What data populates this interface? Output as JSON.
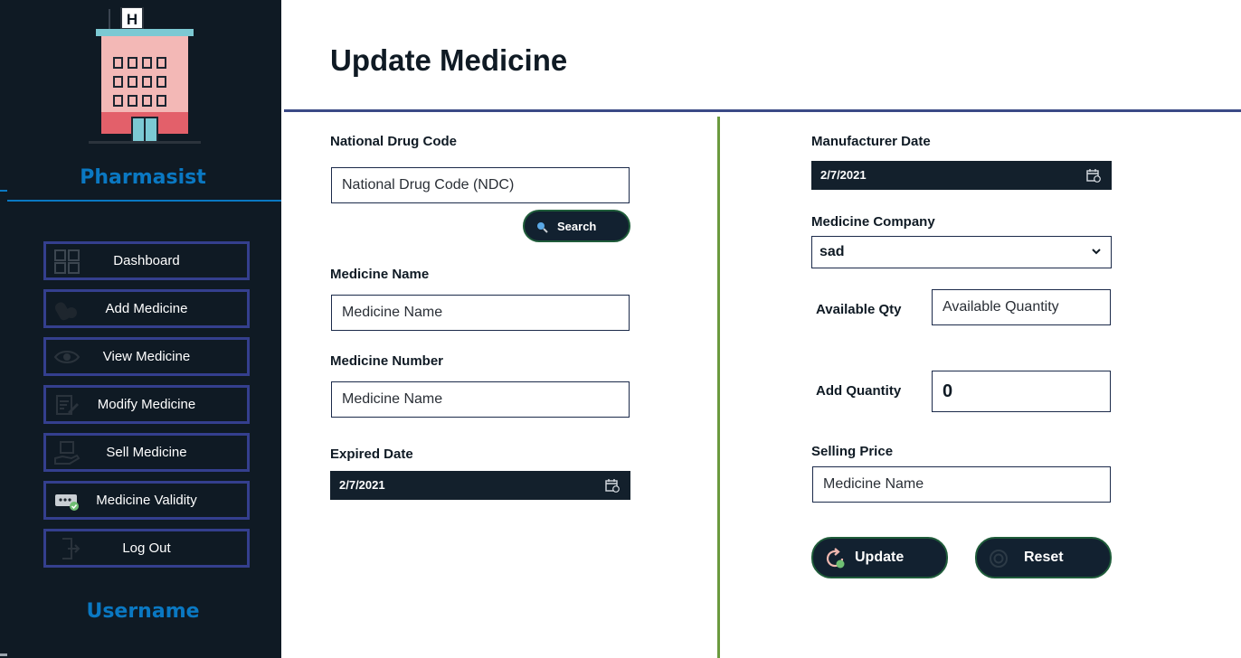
{
  "sidebar": {
    "role": "Pharmasist",
    "username": "Username",
    "items": [
      {
        "label": "Dashboard"
      },
      {
        "label": "Add Medicine"
      },
      {
        "label": "View Medicine"
      },
      {
        "label": "Modify Medicine"
      },
      {
        "label": "Sell Medicine"
      },
      {
        "label": "Medicine Validity"
      },
      {
        "label": "Log Out"
      }
    ]
  },
  "main": {
    "title": "Update Medicine",
    "left": {
      "ndc_label": "National Drug Code",
      "ndc_placeholder": "National Drug Code (NDC)",
      "search_label": "Search",
      "name_label": "Medicine Name",
      "name_placeholder": "Medicine Name",
      "number_label": "Medicine Number",
      "number_placeholder": "Medicine Name",
      "expired_label": "Expired Date",
      "expired_value": "2/7/2021"
    },
    "right": {
      "mfg_label": "Manufacturer Date",
      "mfg_value": "2/7/2021",
      "company_label": "Medicine Company",
      "company_value": "sad",
      "avail_label": "Available Qty",
      "avail_placeholder": "Available Quantity",
      "add_label": "Add Quantity",
      "add_value": "0",
      "price_label": "Selling Price",
      "price_placeholder": "Medicine Name",
      "update_label": "Update",
      "reset_label": "Reset"
    }
  },
  "colors": {
    "sidebar_bg": "#0f1a24",
    "accent_blue": "#0a78c2",
    "nav_border": "#343f8e",
    "divider_green": "#6b9a3e"
  }
}
